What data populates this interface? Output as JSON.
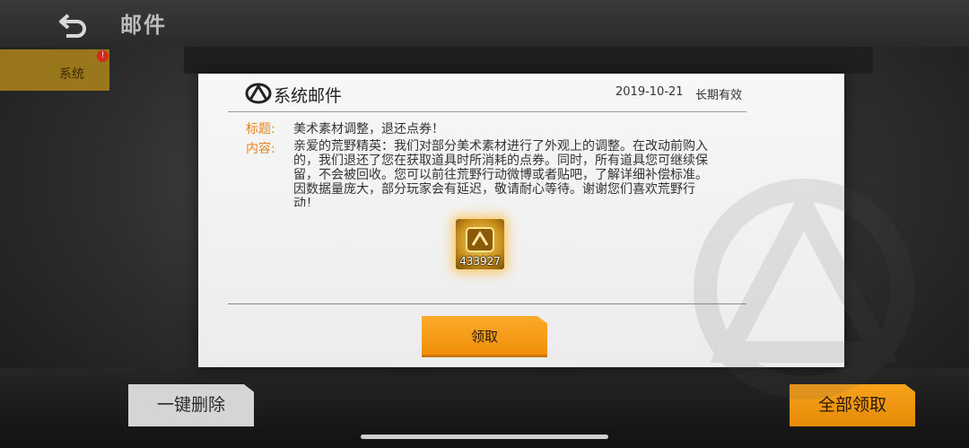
{
  "header": {
    "back_icon": "undo-arrow-icon",
    "title": "邮件"
  },
  "sidebar": {
    "tab_label": "系统",
    "notification_badge": "!"
  },
  "modal": {
    "title": "系统邮件",
    "date": "2019-10-21",
    "validity": "长期有效",
    "subject_label": "标题:",
    "subject": "美术素材调整，退还点券！",
    "content_label": "内容:",
    "content": "亲爱的荒野精英：我们对部分美术素材进行了外观上的调整。在改动前购入的，我们退还了您在获取道具时所消耗的点券。同时，所有道具您可继续保留，不会被回收。您可以前往荒野行动微博或者贴吧，了解详细补偿标准。因数据量庞大，部分玩家会有延迟，敬请耐心等待。谢谢您们喜欢荒野行动！",
    "reward": {
      "icon": "coupon-icon",
      "quantity": "433927"
    },
    "claim_label": "领取"
  },
  "footer": {
    "delete_all_label": "一键删除",
    "claim_all_label": "全部领取"
  },
  "colors": {
    "accent_orange": "#f39c12",
    "label_orange": "#e8841e",
    "badge_red": "#d42a1a"
  }
}
